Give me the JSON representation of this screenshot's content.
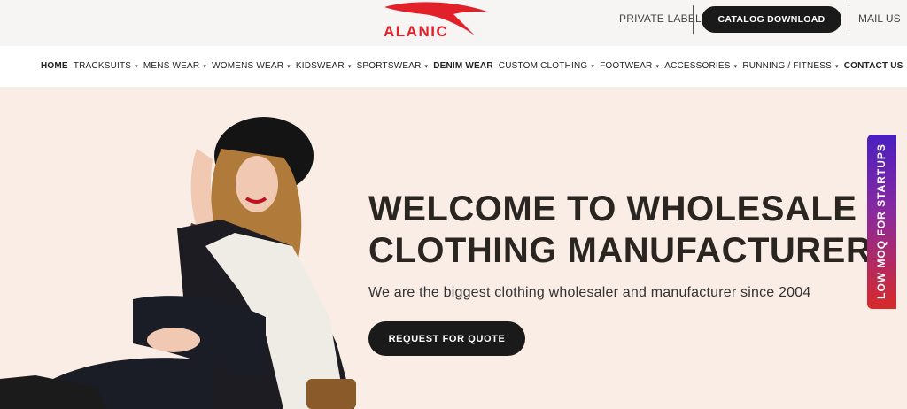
{
  "brand": {
    "name": "ALANIC",
    "color": "#e2202a"
  },
  "header": {
    "private_label": "PRIVATE LABEL",
    "catalog_button": "CATALOG DOWNLOAD",
    "mail_us": "MAIL US"
  },
  "nav": {
    "items": [
      {
        "label": "HOME",
        "dropdown": false
      },
      {
        "label": "TRACKSUITS",
        "dropdown": true
      },
      {
        "label": "MENS WEAR",
        "dropdown": true
      },
      {
        "label": "WOMENS WEAR",
        "dropdown": true
      },
      {
        "label": "KIDSWEAR",
        "dropdown": true
      },
      {
        "label": "SPORTSWEAR",
        "dropdown": true
      },
      {
        "label": "DENIM WEAR",
        "dropdown": false
      },
      {
        "label": "CUSTOM CLOTHING",
        "dropdown": true
      },
      {
        "label": "FOOTWEAR",
        "dropdown": true
      },
      {
        "label": "ACCESSORIES",
        "dropdown": true
      },
      {
        "label": "RUNNING / FITNESS",
        "dropdown": true
      },
      {
        "label": "CONTACT US",
        "dropdown": false
      }
    ]
  },
  "hero": {
    "title_line1": "WELCOME TO WHOLESALE",
    "title_line2": "CLOTHING MANUFACTURER",
    "subtitle": "We are the biggest clothing wholesaler and manufacturer since 2004",
    "cta": "REQUEST FOR QUOTE",
    "background": "#f9ede6"
  },
  "side_tab": {
    "label": "LOW MOQ FOR STARTUPS"
  }
}
